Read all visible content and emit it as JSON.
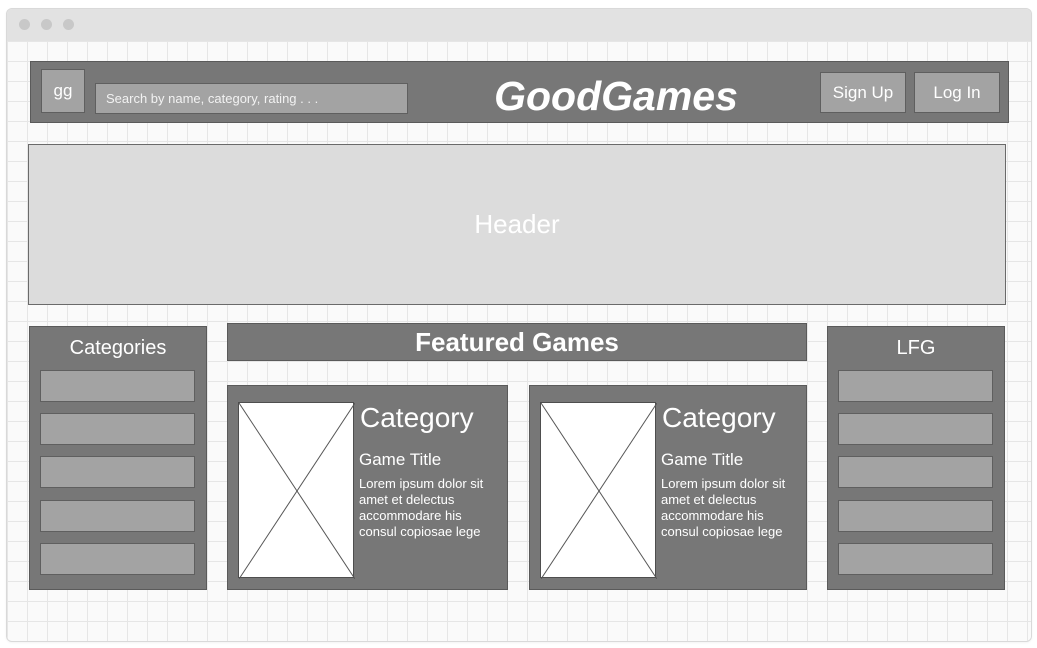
{
  "nav": {
    "logo": "gg",
    "search_placeholder": "Search by name, category, rating . . .",
    "brand": "GoodGames",
    "signup_label": "Sign Up",
    "login_label": "Log In"
  },
  "header": {
    "label": "Header"
  },
  "sidebar_left": {
    "title": "Categories",
    "items": [
      "",
      "",
      "",
      "",
      ""
    ]
  },
  "featured": {
    "title": "Featured Games",
    "cards": [
      {
        "category": "Category",
        "title": "Game Title",
        "description": "Lorem ipsum dolor sit amet et delectus accommodare his consul copiosae lege"
      },
      {
        "category": "Category",
        "title": "Game Title",
        "description": "Lorem ipsum dolor sit amet et delectus accommodare his consul copiosae lege"
      }
    ]
  },
  "sidebar_right": {
    "title": "LFG",
    "items": [
      "",
      "",
      "",
      "",
      ""
    ]
  },
  "colors": {
    "panel": "#777777",
    "field": "#a3a3a3",
    "header_bg": "#dcdcdc",
    "text": "#ffffff"
  }
}
